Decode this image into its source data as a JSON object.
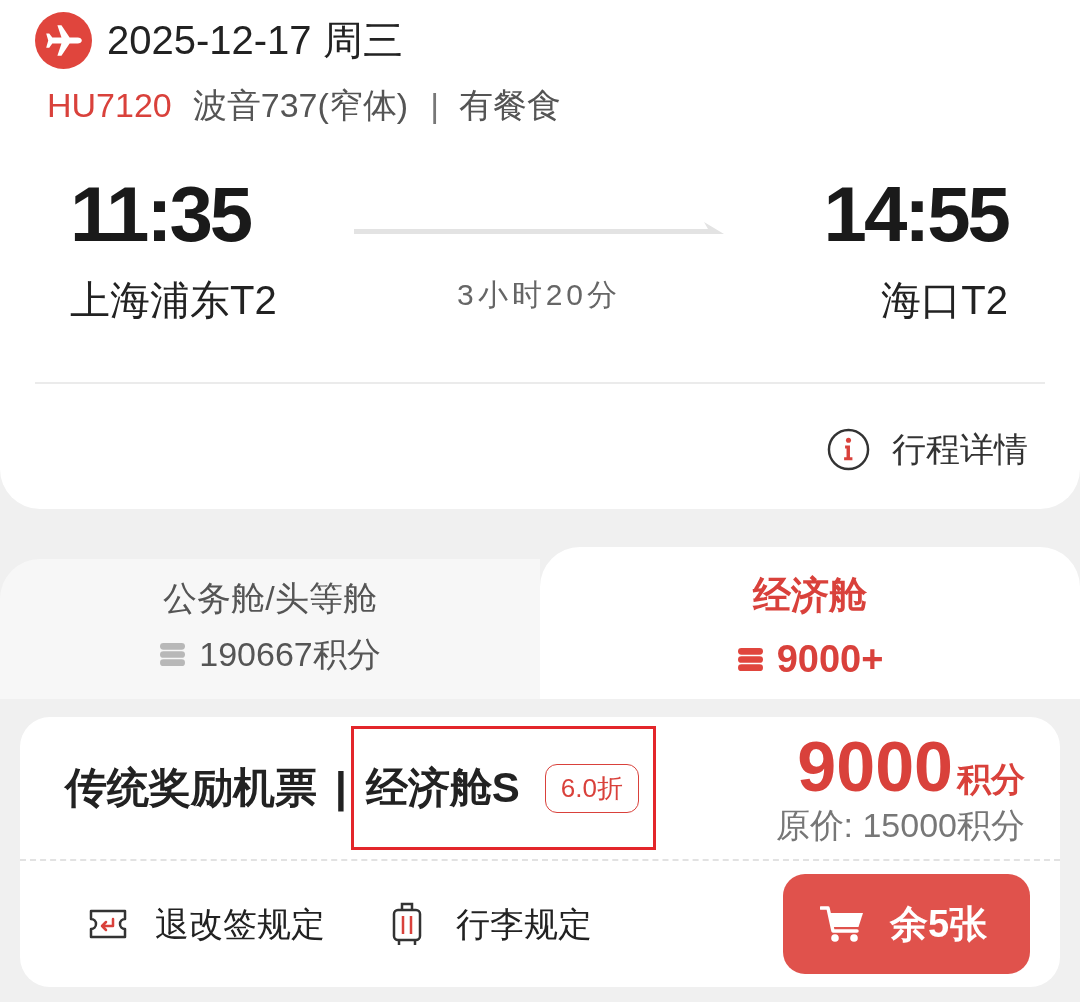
{
  "flight": {
    "date": "2025-12-17 周三",
    "flight_no": "HU7120",
    "aircraft": "波音737(窄体)",
    "separator": "|",
    "meal": "有餐食"
  },
  "departure": {
    "time": "11:35",
    "airport": "上海浦东T2"
  },
  "duration": "3小时20分",
  "arrival": {
    "time": "14:55",
    "airport": "海口T2"
  },
  "details_link": "行程详情",
  "cabin_tabs": [
    {
      "label": "公务舱/头等舱",
      "points": "190667积分",
      "selected": false
    },
    {
      "label": "经济舱",
      "points": "9000+",
      "selected": true
    }
  ],
  "fare": {
    "product": "传统奖励机票",
    "separator": "|",
    "cabin": "经济舱S",
    "discount": "6.0折",
    "highlighted": true,
    "price": "9000",
    "price_unit": "积分",
    "original_price": "原价: 15000积分"
  },
  "rules": [
    {
      "kind": "refund",
      "label": "退改签规定"
    },
    {
      "kind": "baggage",
      "label": "行李规定"
    }
  ],
  "book_button": "余5张"
}
